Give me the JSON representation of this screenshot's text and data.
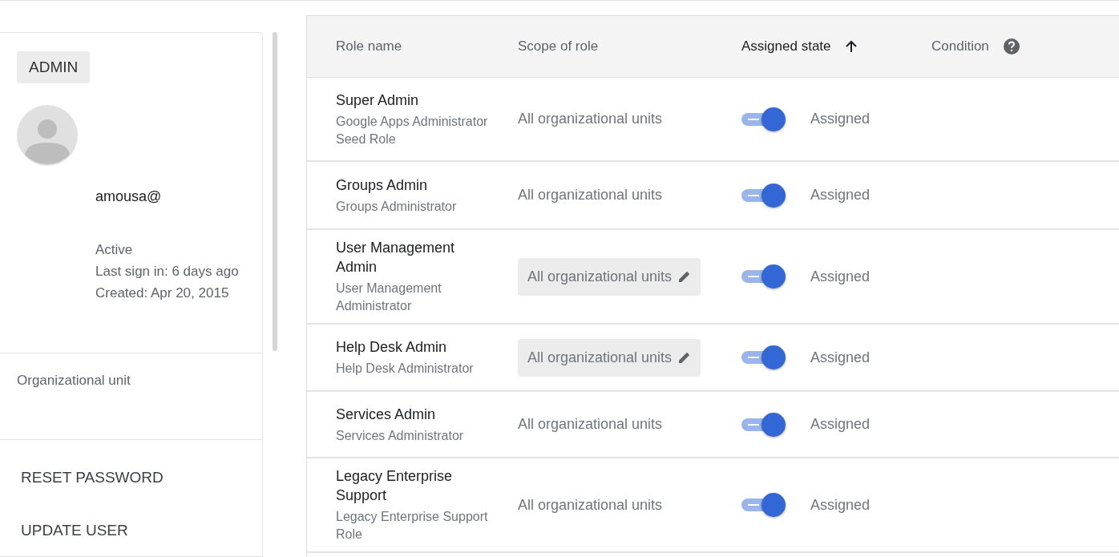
{
  "user": {
    "badge": "ADMIN",
    "email": "amousa@",
    "status": "Active",
    "last_sign_in": "Last sign in: 6 days ago",
    "created": "Created: Apr 20, 2015",
    "org_unit_label": "Organizational unit"
  },
  "actions": [
    "RESET PASSWORD",
    "UPDATE USER"
  ],
  "table": {
    "columns": [
      {
        "label": "Role name",
        "sorted": false
      },
      {
        "label": "Scope of role",
        "sorted": false
      },
      {
        "label": "Assigned state",
        "sorted": true
      },
      {
        "label": "Condition",
        "sorted": false,
        "help": true
      }
    ],
    "rows": [
      {
        "name": "Super Admin",
        "description": "Google Apps Administrator Seed Role",
        "scope": "All organizational units",
        "scope_editable": false,
        "on": true,
        "state": "Assigned"
      },
      {
        "name": "Groups Admin",
        "description": "Groups Administrator",
        "scope": "All organizational units",
        "scope_editable": false,
        "on": true,
        "state": "Assigned"
      },
      {
        "name": "User Management Admin",
        "description": "User Management Administrator",
        "scope": "All organizational units",
        "scope_editable": true,
        "on": true,
        "state": "Assigned"
      },
      {
        "name": "Help Desk Admin",
        "description": "Help Desk Administrator",
        "scope": "All organizational units",
        "scope_editable": true,
        "on": true,
        "state": "Assigned"
      },
      {
        "name": "Services Admin",
        "description": "Services Administrator",
        "scope": "All organizational units",
        "scope_editable": false,
        "on": true,
        "state": "Assigned"
      },
      {
        "name": "Legacy Enterprise Support",
        "description": "Legacy Enterprise Support Role",
        "scope": "All organizational units",
        "scope_editable": false,
        "on": true,
        "state": "Assigned"
      }
    ]
  }
}
